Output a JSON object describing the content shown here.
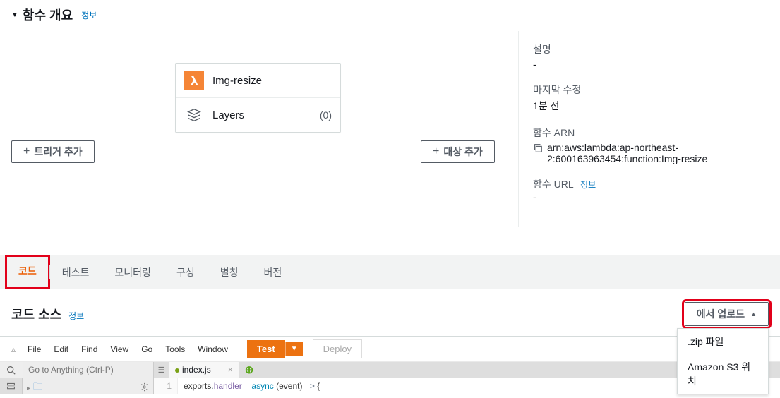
{
  "overview": {
    "title": "함수 개요",
    "info": "정보",
    "function_name": "Img-resize",
    "layers_label": "Layers",
    "layers_count": "(0)",
    "add_trigger": "트리거 추가",
    "add_target": "대상 추가"
  },
  "meta": {
    "desc_label": "설명",
    "desc_value": "-",
    "modified_label": "마지막 수정",
    "modified_value": "1분 전",
    "arn_label": "함수 ARN",
    "arn_value": "arn:aws:lambda:ap-northeast-2:600163963454:function:Img-resize",
    "url_label": "함수 URL",
    "url_info": "정보",
    "url_value": "-"
  },
  "tabs": {
    "items": [
      {
        "label": "코드"
      },
      {
        "label": "테스트"
      },
      {
        "label": "모니터링"
      },
      {
        "label": "구성"
      },
      {
        "label": "별칭"
      },
      {
        "label": "버전"
      }
    ]
  },
  "code_source": {
    "title": "코드 소스",
    "info": "정보",
    "upload_label": "에서 업로드",
    "upload_menu": {
      "zip": ".zip 파일",
      "s3": "Amazon S3 위치"
    }
  },
  "ide": {
    "menu": {
      "file": "File",
      "edit": "Edit",
      "find": "Find",
      "view": "View",
      "go": "Go",
      "tools": "Tools",
      "window": "Window"
    },
    "test": "Test",
    "deploy": "Deploy",
    "goto_placeholder": "Go to Anything (Ctrl-P)",
    "tab": {
      "name": "index.js"
    },
    "line1": {
      "exports": "exports",
      "dot": ".",
      "handler": "handler",
      "eq": " = ",
      "async": "async",
      "sp": " ",
      "lp": "(",
      "event": "event",
      "rp": ")",
      "arrow": " => ",
      "lb": "{"
    }
  }
}
